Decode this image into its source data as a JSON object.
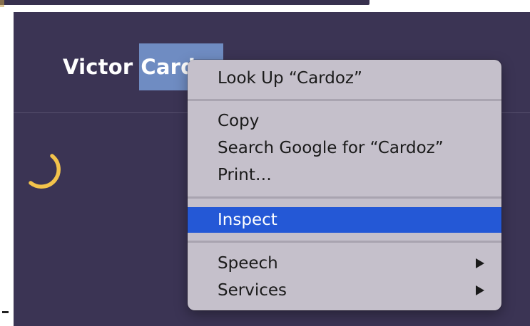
{
  "app": {
    "name_first": "Victor",
    "name_last": "Cardoz",
    "background_color": "#3b3454",
    "spinner_color": "#f3c34b",
    "selection_color": "#6f8cc2"
  },
  "context_menu": {
    "highlight_color": "#2458d6",
    "items": [
      {
        "label": "Look Up “Cardoz”",
        "selected": false,
        "submenu": false
      },
      {
        "label": "Copy",
        "selected": false,
        "submenu": false
      },
      {
        "label": "Search Google for “Cardoz”",
        "selected": false,
        "submenu": false
      },
      {
        "label": "Print…",
        "selected": false,
        "submenu": false
      },
      {
        "label": "Inspect",
        "selected": true,
        "submenu": false
      },
      {
        "label": "Speech",
        "selected": false,
        "submenu": true,
        "submenu_icon": "chevron-right-icon"
      },
      {
        "label": "Services",
        "selected": false,
        "submenu": true,
        "submenu_icon": "chevron-right-icon"
      }
    ]
  }
}
